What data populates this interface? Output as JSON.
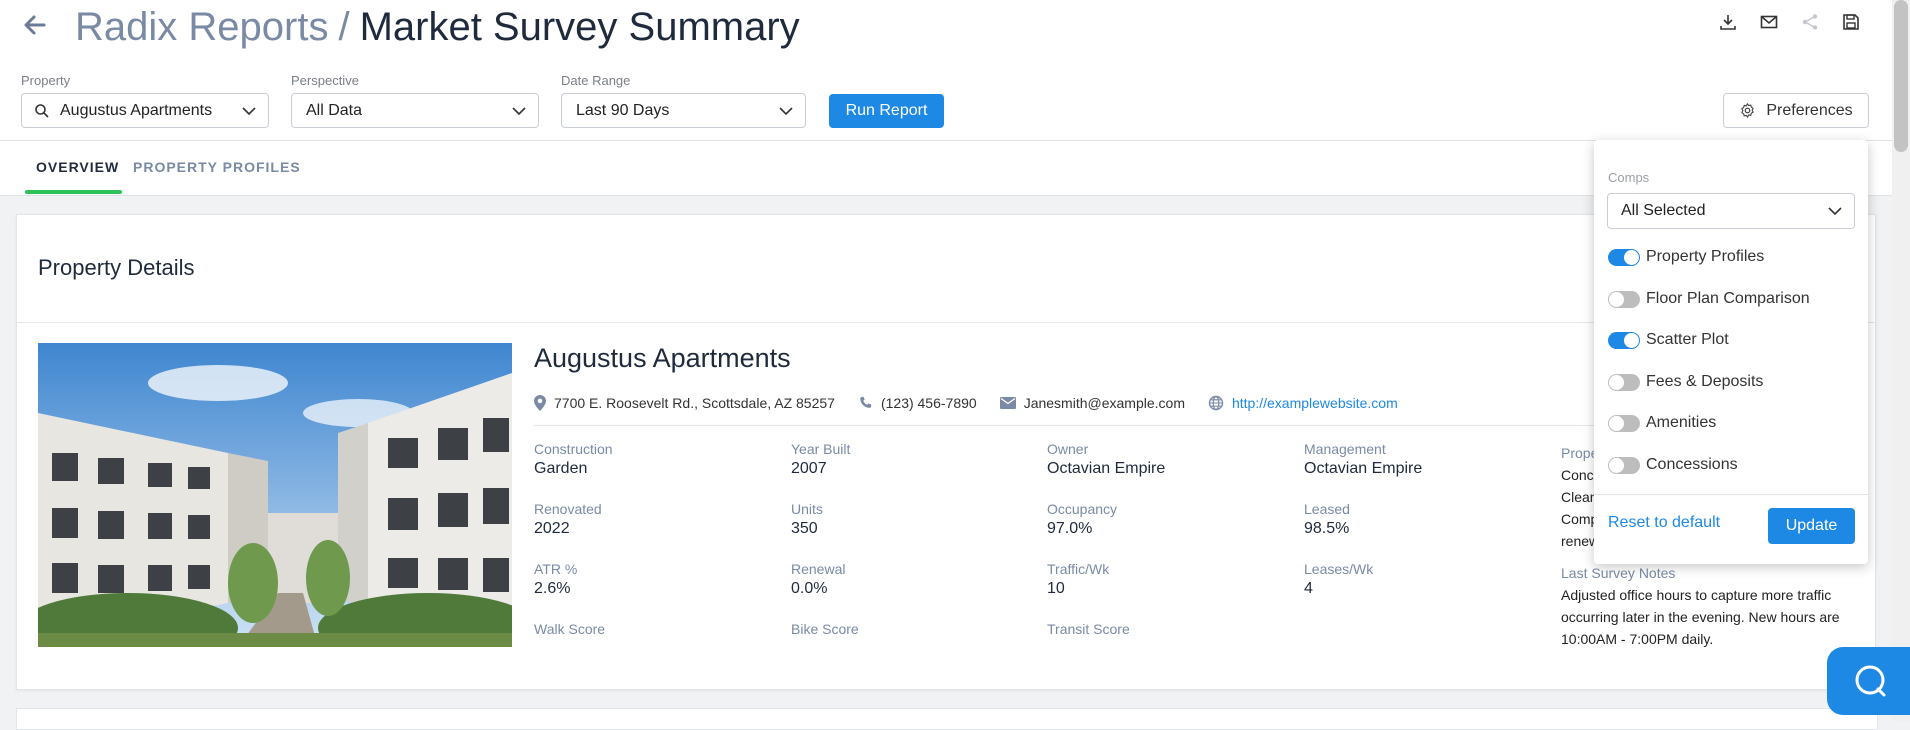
{
  "header": {
    "crumb": "Radix Reports",
    "separator": "/",
    "page_title": "Market Survey Summary"
  },
  "filters": {
    "property_label": "Property",
    "property_value": "Augustus Apartments",
    "perspective_label": "Perspective",
    "perspective_value": "All Data",
    "date_range_label": "Date Range",
    "date_range_value": "Last 90 Days",
    "run_report_label": "Run Report",
    "preferences_label": "Preferences"
  },
  "tabs": [
    {
      "label": "OVERVIEW",
      "active": true
    },
    {
      "label": "PROPERTY PROFILES",
      "active": false
    }
  ],
  "property_details": {
    "section_title": "Property Details",
    "name": "Augustus Apartments",
    "address": "7700 E. Roosevelt Rd., Scottsdale, AZ 85257",
    "phone": "(123) 456-7890",
    "email": "Janesmith@example.com",
    "website": "http://examplewebsite.com",
    "metrics": {
      "construction": {
        "label": "Construction",
        "value": "Garden"
      },
      "year_built": {
        "label": "Year Built",
        "value": "2007"
      },
      "owner": {
        "label": "Owner",
        "value": "Octavian Empire"
      },
      "management": {
        "label": "Management",
        "value": "Octavian Empire"
      },
      "renovated": {
        "label": "Renovated",
        "value": "2022"
      },
      "units": {
        "label": "Units",
        "value": "350"
      },
      "occupancy": {
        "label": "Occupancy",
        "value": "97.0%"
      },
      "leased": {
        "label": "Leased",
        "value": "98.5%"
      },
      "atr": {
        "label": "ATR %",
        "value": "2.6%"
      },
      "renewal": {
        "label": "Renewal",
        "value": "0.0%"
      },
      "traffic": {
        "label": "Traffic/Wk",
        "value": "10"
      },
      "leases_wk": {
        "label": "Leases/Wk",
        "value": "4"
      },
      "walk_score": {
        "label": "Walk Score"
      },
      "bike_score": {
        "label": "Bike Score"
      },
      "transit_score": {
        "label": "Transit Score"
      }
    },
    "side_partial": {
      "label": "Prope",
      "lines": [
        "Conc",
        "Clean",
        "Comp",
        "renew"
      ]
    },
    "survey_notes": {
      "label": "Last Survey Notes",
      "text": "Adjusted office hours to capture more traffic occurring later in the evening. New hours are 10:00AM - 7:00PM daily."
    }
  },
  "preferences_panel": {
    "comps_label": "Comps",
    "comps_value": "All Selected",
    "toggles": [
      {
        "label": "Property Profiles",
        "on": true
      },
      {
        "label": "Floor Plan Comparison",
        "on": false
      },
      {
        "label": "Scatter Plot",
        "on": true
      },
      {
        "label": "Fees & Deposits",
        "on": false
      },
      {
        "label": "Amenities",
        "on": false
      },
      {
        "label": "Concessions",
        "on": false
      }
    ],
    "reset_label": "Reset to default",
    "update_label": "Update"
  },
  "icons": {
    "back": "arrow-left-icon",
    "download": "download-icon",
    "email": "mail-icon",
    "share": "share-icon",
    "save": "save-icon",
    "search": "search-icon",
    "gear": "gear-icon",
    "location": "location-pin-icon",
    "phone": "phone-icon",
    "envelope": "envelope-icon",
    "globe": "globe-icon",
    "help": "chat-bubble-icon"
  },
  "colors": {
    "accent": "#1e88e5",
    "tab_underline": "#2ec25a",
    "title_dark": "#1f2a3d",
    "muted": "#7a8aa5"
  }
}
